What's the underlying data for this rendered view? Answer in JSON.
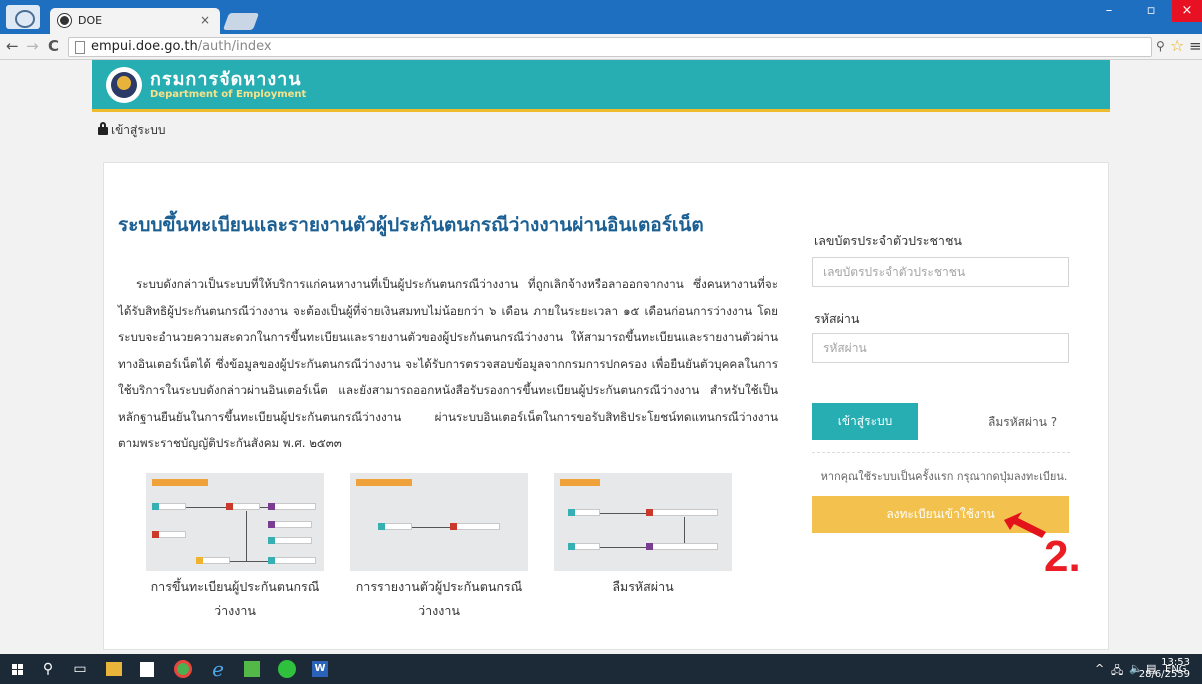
{
  "browser": {
    "tab_title": "DOE",
    "tab_close": "×",
    "url_host": "empui.doe.go.th",
    "url_path": "/auth/index",
    "window_controls": {
      "minimize": "–",
      "maximize": "▫",
      "close": "×"
    },
    "nav": {
      "back": "←",
      "forward": "→",
      "reload": "C"
    },
    "icons": [
      "chrome-icon",
      "page-icon",
      "star-icon",
      "menu-icon",
      "extension-icon"
    ]
  },
  "site": {
    "name": "กรมการจัดหางาน",
    "subtitle": "Department of Employment",
    "breadcrumb": "เข้าสู่ระบบ",
    "colors": {
      "header": "#27aeb3",
      "header_border": "#f0ba2d",
      "title": "#1b5f93",
      "register_button": "#f3c14d"
    }
  },
  "main": {
    "title": "ระบบขึ้นทะเบียนและรายงานตัวผู้ประกันตนกรณีว่างงานผ่านอินเตอร์เน็ต",
    "description": "ระบบดังกล่าวเป็นระบบที่ให้บริการแก่คนหางานที่เป็นผู้ประกันตนกรณีว่างงาน ที่ถูกเลิกจ้างหรือลาออกจากงาน ซึ่งคนหางานที่จะได้รับสิทธิผู้ประกันตนกรณีว่างงาน จะต้องเป็นผู้ที่จ่ายเงินสมทบไม่น้อยกว่า ๖ เดือน ภายในระยะเวลา ๑๕ เดือนก่อนการว่างงาน โดยระบบจะอำนวยความสะดวกในการขึ้นทะเบียนและรายงานตัวของผู้ประกันตนกรณีว่างงาน ให้สามารถขึ้นทะเบียนและรายงานตัวผ่านทางอินเตอร์เน็ตได้ ซึ่งข้อมูลของผู้ประกันตนกรณีว่างงาน จะได้รับการตรวจสอบข้อมูลจากกรมการปกครอง เพื่อยืนยันตัวบุคคลในการใช้บริการในระบบดังกล่าวผ่านอินเตอร์เน็ต และยังสามารถออกหนังสือรับรองการขึ้นทะเบียนผู้ประกันตนกรณีว่างงาน สำหรับใช้เป็นหลักฐานยืนยันในการขึ้นทะเบียนผู้ประกันตนกรณีว่างงาน ผ่านระบบอินเตอร์เน็ตในการขอรับสิทธิประโยชน์ทดแทนกรณีว่างงาน ตามพระราชบัญญัติประกันสังคม พ.ศ. ๒๕๓๓",
    "thumbnails": [
      {
        "label": "การขึ้นทะเบียนผู้ประกันตนกรณีว่างงาน"
      },
      {
        "label": "การรายงานตัวผู้ประกันตนกรณีว่างงาน"
      },
      {
        "label": "ลืมรหัสผ่าน"
      }
    ]
  },
  "login": {
    "id_label": "เลขบัตรประจำตัวประชาชน",
    "id_placeholder": "เลขบัตรประจำตัวประชาชน",
    "id_value": "",
    "password_label": "รหัสผ่าน",
    "password_placeholder": "รหัสผ่าน",
    "password_value": "",
    "login_button": "เข้าสู่ระบบ",
    "forgot_link": "ลืมรหัสผ่าน ?",
    "first_time_hint": "หากคุณใช้ระบบเป็นครั้งแรก กรุณากดปุ่มลงทะเบียน.",
    "register_button": "ลงทะเบียนเข้าใช้งาน"
  },
  "annotation": {
    "step": "2."
  },
  "taskbar": {
    "apps": [
      "start-icon",
      "search-icon",
      "task-view-icon",
      "file-explorer-icon",
      "store-icon",
      "chrome-icon",
      "edge-icon",
      "app-icon",
      "line-icon",
      "word-icon"
    ],
    "edge_glyph": "e",
    "word_glyph": "W",
    "tray": {
      "up": "^",
      "network": "🖧",
      "volume": "🔈",
      "message": "▤",
      "language": "ENG"
    },
    "time": "13:53",
    "date": "28/6/2559"
  }
}
